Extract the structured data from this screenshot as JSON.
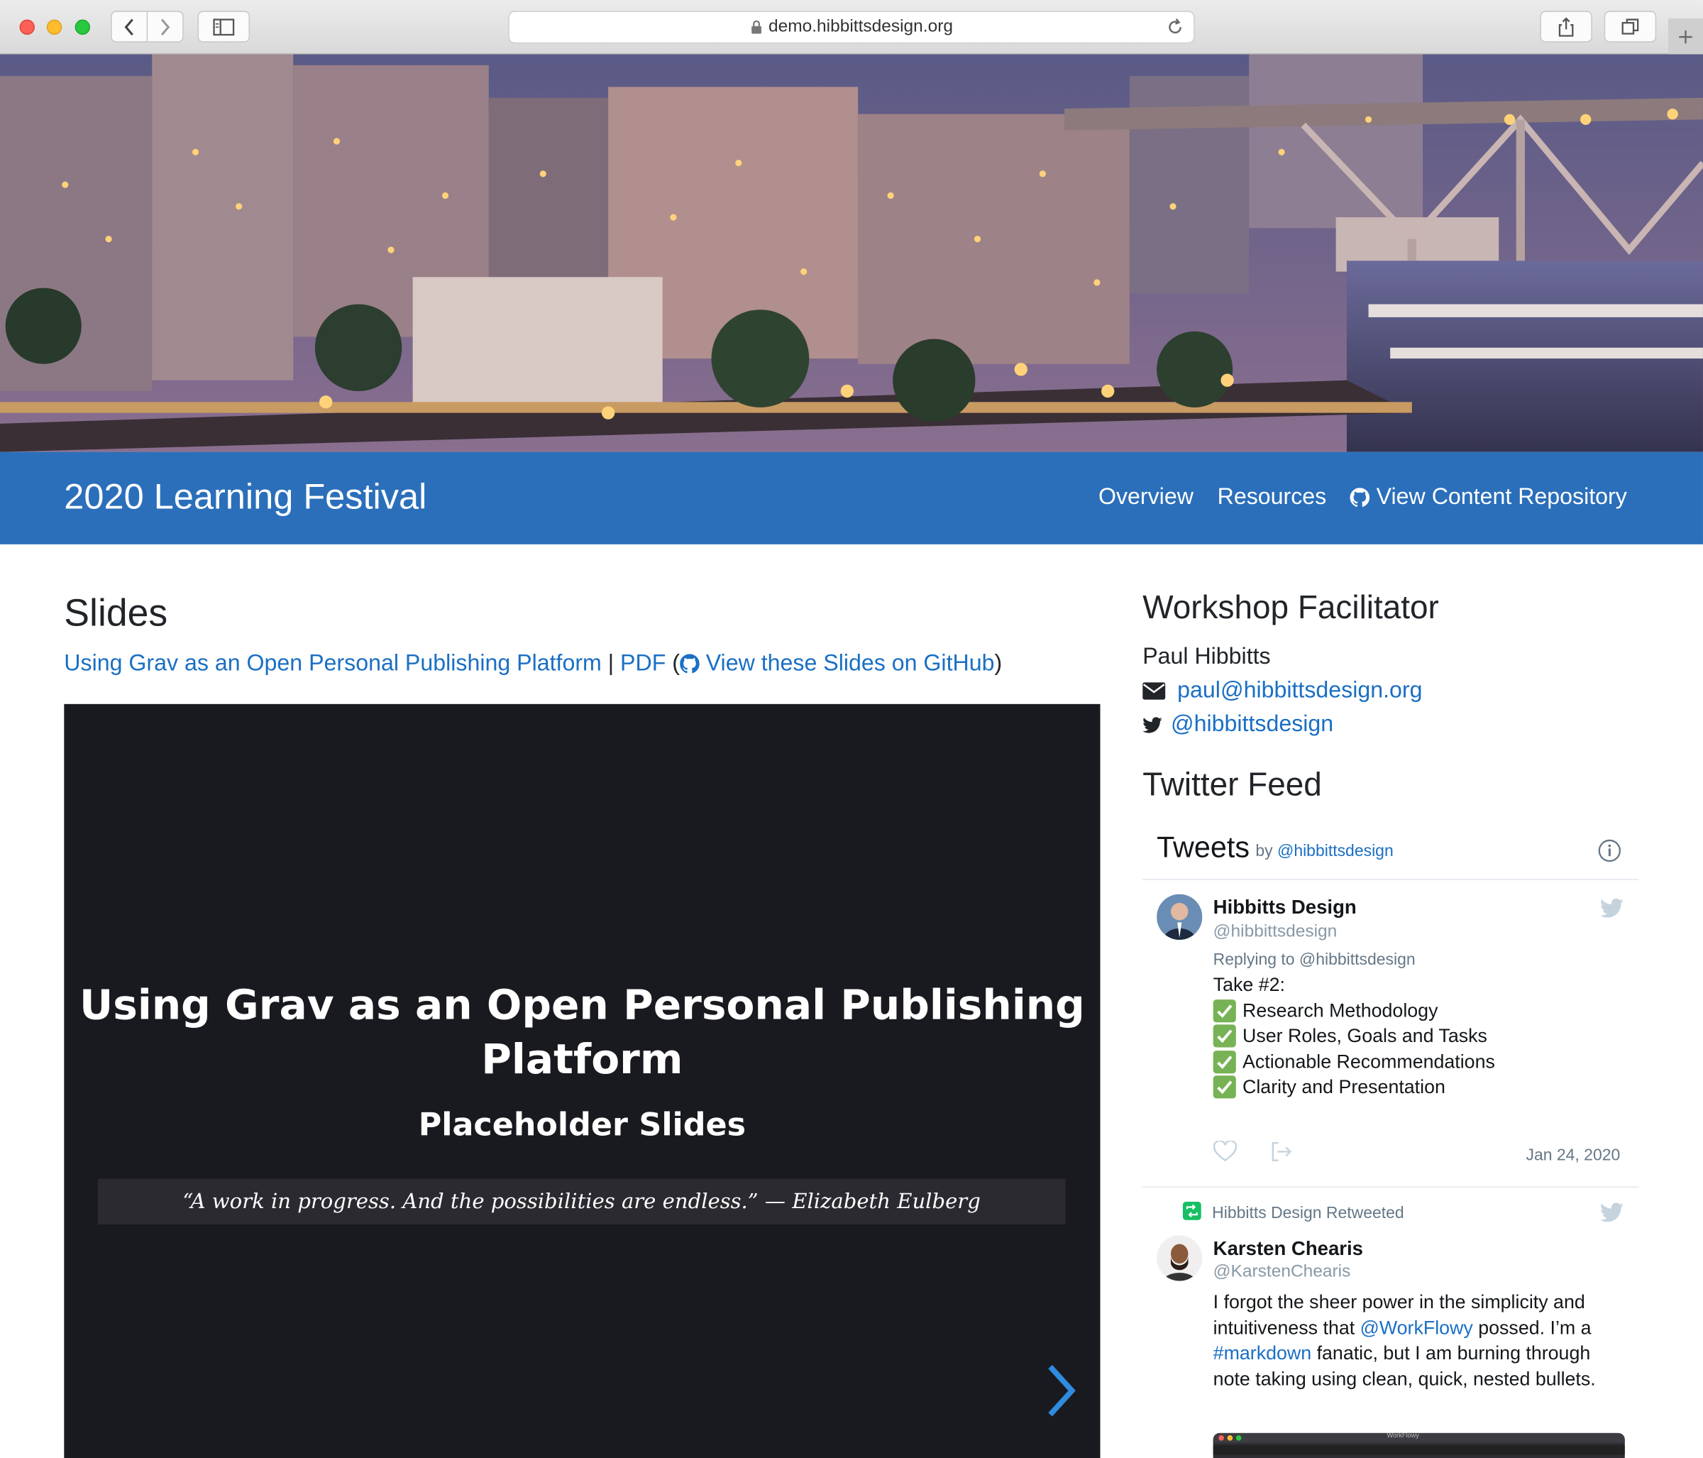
{
  "browser": {
    "url": "demo.hibbittsdesign.org"
  },
  "site": {
    "title": "2020 Learning Festival",
    "nav": [
      {
        "label": "Overview"
      },
      {
        "label": "Resources"
      },
      {
        "label": "View Content Repository",
        "icon": "github-icon"
      }
    ]
  },
  "main": {
    "heading": "Slides",
    "links": {
      "presentation": "Using Grav as an Open Personal Publishing Platform",
      "separator": " | ",
      "pdf": "PDF",
      "paren_open": " (",
      "github": "View these Slides on GitHub",
      "paren_close": ")"
    },
    "slide": {
      "title": "Using Grav as an Open Personal Publishing Platform",
      "subtitle": "Placeholder Slides",
      "quote": "“A work in progress. And the possibilities are endless.” — Elizabeth Eulberg"
    }
  },
  "sidebar": {
    "facilitator_heading": "Workshop Facilitator",
    "facilitator_name": "Paul Hibbitts",
    "email": "paul@hibbittsdesign.org",
    "twitter": "@hibbittsdesign",
    "feed_heading": "Twitter Feed",
    "widget": {
      "title": "Tweets",
      "by_label": "by",
      "by_handle": "@hibbittsdesign",
      "tweets": [
        {
          "name": "Hibbitts Design",
          "handle": "@hibbittsdesign",
          "reply_to": "Replying to @hibbittsdesign",
          "lead": "Take #2:",
          "items": [
            "Research Methodology",
            "User Roles, Goals and Tasks",
            "Actionable Recommendations",
            "Clarity and Presentation"
          ],
          "date": "Jan 24, 2020"
        },
        {
          "retweet_label": "Hibbitts Design Retweeted",
          "name": "Karsten Chearis",
          "handle": "@KarstenChearis",
          "text_1": "I forgot the sheer power in the simplicity and",
          "text_2a": "intuitiveness that ",
          "text_2_mention": "@WorkFlowy",
          "text_2b": " possed. I’m a",
          "text_3_tag": "#markdown",
          "text_3b": " fanatic, but I am burning through",
          "text_4": "note taking using clean, quick, nested bullets.",
          "media_title": "WorkFlowy"
        }
      ]
    }
  },
  "colors": {
    "brand_blue": "#2b6fba",
    "link": "#1a6fc4",
    "slide_bg": "#191a1f"
  }
}
